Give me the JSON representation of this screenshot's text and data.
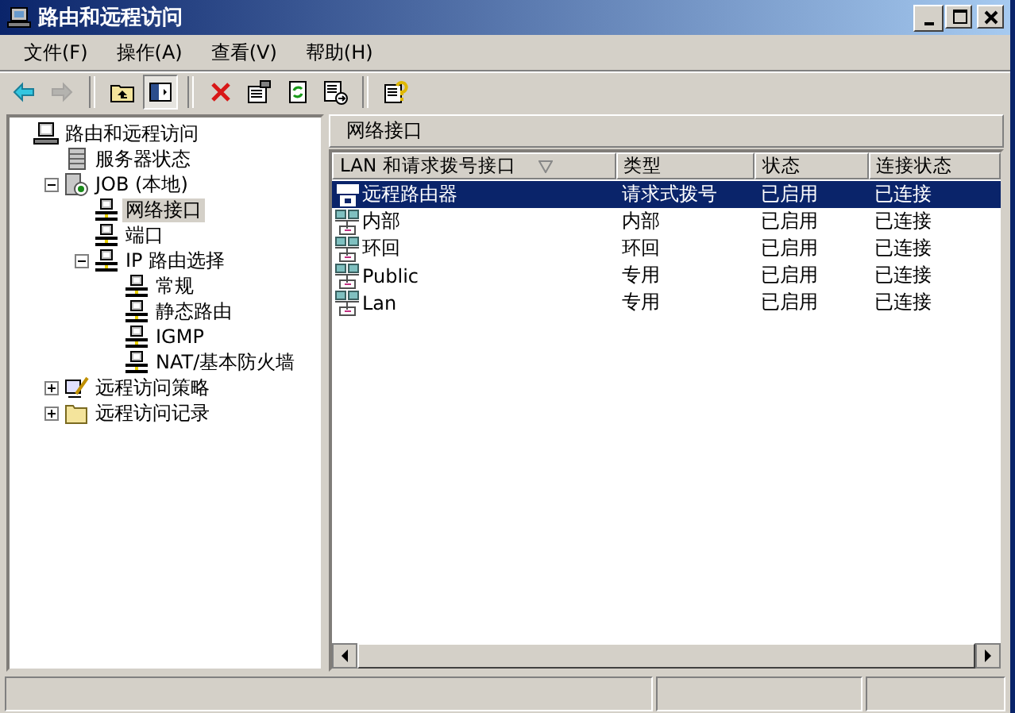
{
  "window": {
    "title": "路由和远程访问"
  },
  "menu": [
    {
      "label": "文件(F)"
    },
    {
      "label": "操作(A)"
    },
    {
      "label": "查看(V)"
    },
    {
      "label": "帮助(H)"
    }
  ],
  "toolbar": [
    {
      "kind": "back",
      "disabled": false,
      "pressed": false
    },
    {
      "kind": "forward",
      "disabled": true,
      "pressed": false
    },
    {
      "kind": "separator"
    },
    {
      "kind": "up",
      "disabled": false,
      "pressed": false
    },
    {
      "kind": "tree",
      "disabled": false,
      "pressed": true
    },
    {
      "kind": "separator"
    },
    {
      "kind": "delete",
      "disabled": false,
      "pressed": false
    },
    {
      "kind": "properties",
      "disabled": false,
      "pressed": false
    },
    {
      "kind": "refresh",
      "disabled": false,
      "pressed": false
    },
    {
      "kind": "export",
      "disabled": false,
      "pressed": false
    },
    {
      "kind": "separator"
    },
    {
      "kind": "help",
      "disabled": false,
      "pressed": false
    }
  ],
  "tree": [
    {
      "label": "路由和远程访问",
      "kind": "computer",
      "selected": false,
      "children": [
        {
          "label": "服务器状态",
          "kind": "server",
          "selected": false
        },
        {
          "label": "JOB (本地)",
          "kind": "local",
          "selected": false,
          "expanded": true,
          "children": [
            {
              "label": "网络接口",
              "kind": "node",
              "selected": true
            },
            {
              "label": "端口",
              "kind": "node",
              "selected": false
            },
            {
              "label": "IP 路由选择",
              "kind": "node",
              "selected": false,
              "expanded": true,
              "children": [
                {
                  "label": "常规",
                  "kind": "node",
                  "selected": false
                },
                {
                  "label": "静态路由",
                  "kind": "node",
                  "selected": false
                },
                {
                  "label": "IGMP",
                  "kind": "node",
                  "selected": false
                },
                {
                  "label": "NAT/基本防火墙",
                  "kind": "node",
                  "selected": false
                }
              ]
            }
          ]
        },
        {
          "label": "远程访问策略",
          "kind": "policy",
          "selected": false,
          "expanded": false
        },
        {
          "label": "远程访问记录",
          "kind": "folder",
          "selected": false,
          "expanded": false
        }
      ]
    }
  ],
  "panel": {
    "title": "网络接口"
  },
  "table": {
    "columns": [
      {
        "label": "LAN 和请求拨号接口",
        "sorted": true
      },
      {
        "label": "类型",
        "sorted": false
      },
      {
        "label": "状态",
        "sorted": false
      },
      {
        "label": "连接状态",
        "sorted": false
      }
    ],
    "rows": [
      {
        "kind": "dial",
        "selected": true,
        "cells": [
          "远程路由器",
          "请求式拨号",
          "已启用",
          "已连接"
        ]
      },
      {
        "kind": "lan",
        "selected": false,
        "cells": [
          "内部",
          "内部",
          "已启用",
          "已连接"
        ]
      },
      {
        "kind": "lan",
        "selected": false,
        "cells": [
          "环回",
          "环回",
          "已启用",
          "已连接"
        ]
      },
      {
        "kind": "lan",
        "selected": false,
        "cells": [
          "Public",
          "专用",
          "已启用",
          "已连接"
        ]
      },
      {
        "kind": "lan",
        "selected": false,
        "cells": [
          "Lan",
          "专用",
          "已启用",
          "已连接"
        ]
      }
    ]
  }
}
